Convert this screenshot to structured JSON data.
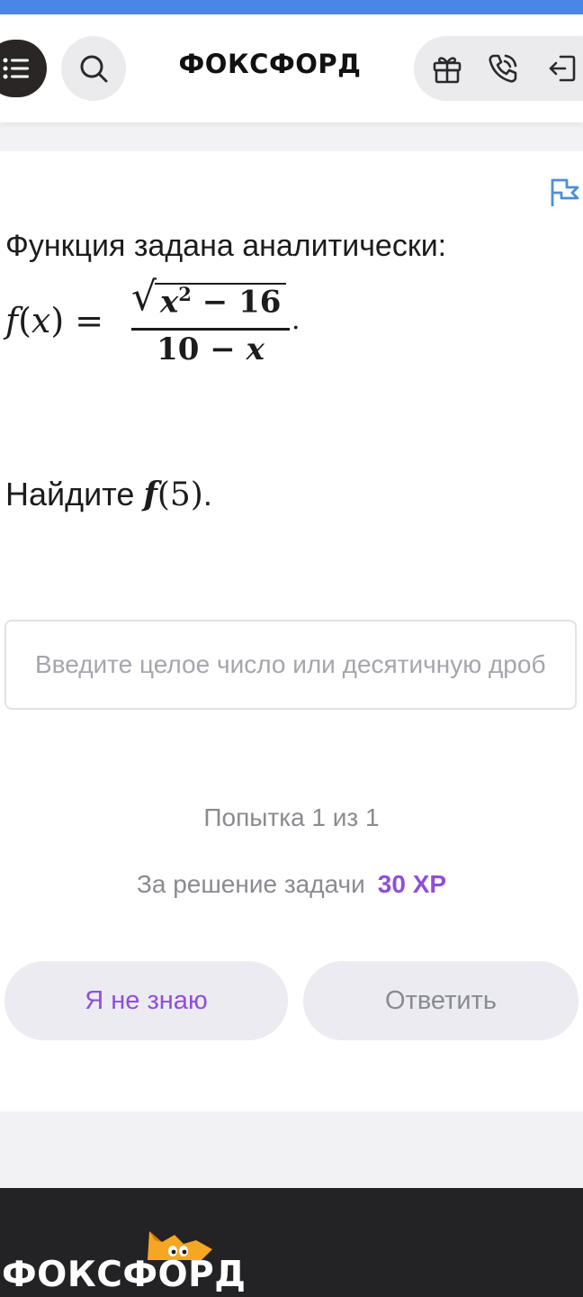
{
  "header": {
    "logo_text": "ФОКСФОРД",
    "icons": [
      "menu-icon",
      "search-icon",
      "gift-icon",
      "phone-icon",
      "logout-icon"
    ]
  },
  "task": {
    "line1": "Функция задана аналитически:",
    "formula": {
      "lhs_f": "f",
      "lhs_open": "(",
      "lhs_x": "x",
      "lhs_close_eq": ") =",
      "num_x": "x",
      "num_exp": "2",
      "num_rest": " − 16",
      "den_const": "10 − ",
      "den_x": "x",
      "tail": "."
    },
    "line2_prefix": "Найдите ",
    "line2_f": "f",
    "line2_args": "(5)",
    "line2_tail": "."
  },
  "answer": {
    "placeholder": "Введите целое число или десятичную дробь"
  },
  "attempts_text": "Попытка 1 из 1",
  "reward": {
    "label": "За решение задачи",
    "xp": "30 XP"
  },
  "buttons": {
    "dont_know": "Я не знаю",
    "answer": "Ответить"
  },
  "footer": {
    "logo_text": "ФОКСФОРД"
  },
  "colors": {
    "accent_purple": "#8e4fd8",
    "top_bar_blue": "#4a86e8",
    "flag_blue": "#4a90d9",
    "footer_dark": "#232326"
  }
}
